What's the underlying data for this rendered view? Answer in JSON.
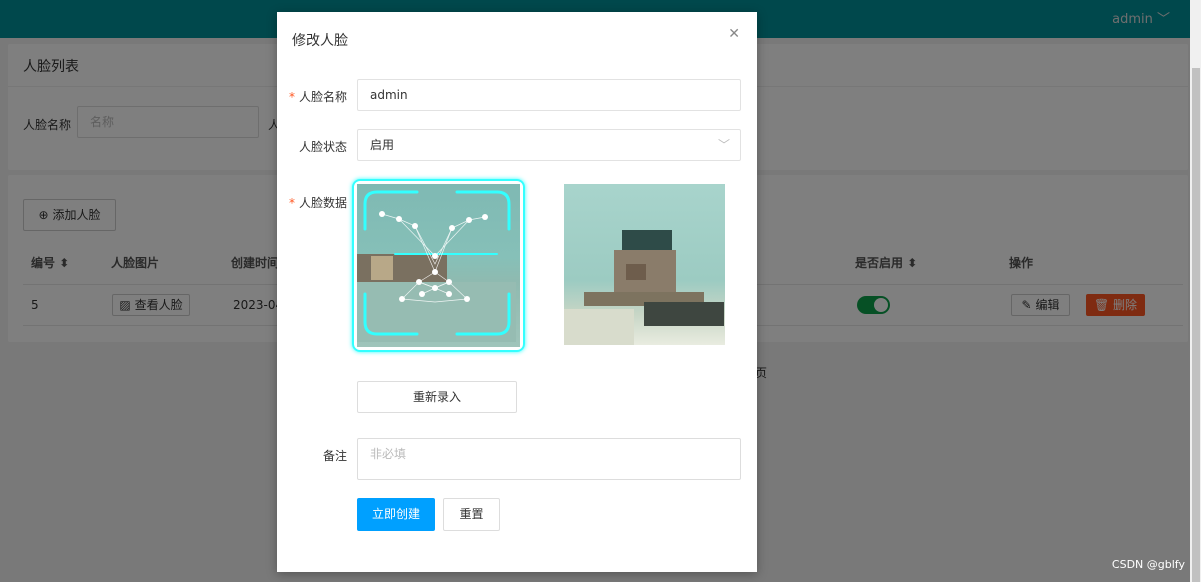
{
  "header": {
    "user": "admin",
    "user_chevron": "chevron-down-icon"
  },
  "list": {
    "title": "人脸列表",
    "search_label": "人脸名称",
    "search_placeholder": "名称",
    "search_label2_partial": "人",
    "add_button": "添加人脸",
    "add_icon": "plus-circle-icon",
    "columns": [
      "编号",
      "人脸图片",
      "创建时间",
      "是否启用",
      "操作"
    ],
    "rows": [
      {
        "id": "5",
        "view_button": "查看人脸",
        "created_partial": "2023-04",
        "enabled": true,
        "edit": "编辑",
        "delete": "删除"
      }
    ],
    "pagination_partial": "页"
  },
  "modal": {
    "title": "修改人脸",
    "name_label": "人脸名称",
    "name_value": "admin",
    "status_label": "人脸状态",
    "status_value": "启用",
    "data_label": "人脸数据",
    "rerecord_button": "重新录入",
    "remark_label": "备注",
    "remark_placeholder": "非必填",
    "submit_button": "立即创建",
    "reset_button": "重置"
  },
  "watermark": "CSDN @gblfy",
  "colors": {
    "header": "#009099",
    "primary": "#00a0ff",
    "danger": "#ff5722",
    "switch_on": "#0ca04a",
    "scan_frame": "#33ffff"
  }
}
